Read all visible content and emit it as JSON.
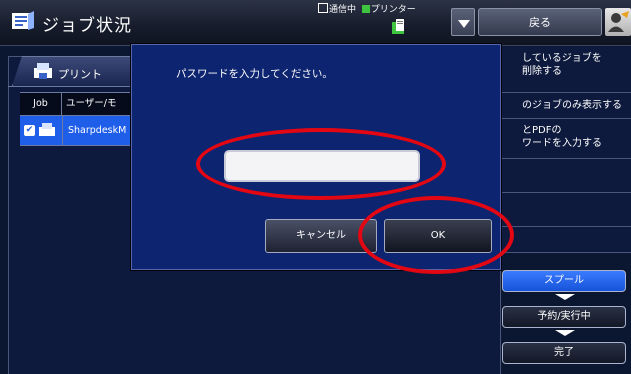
{
  "header": {
    "title": "ジョブ状況",
    "status_comm": "通信中",
    "status_printer": "プリンター",
    "back_label": "戻る",
    "title_icon": "job-status-icon",
    "user_icon": "user-icon",
    "dropdown_icon": "chevron-down-icon"
  },
  "panel": {
    "tab_label": "プリント",
    "tab_icon": "printer-icon",
    "table": {
      "columns": [
        "Job",
        "ユーザー/モ"
      ],
      "rows": [
        {
          "user": "SharpdeskM",
          "selected": true
        }
      ]
    }
  },
  "sidebar": {
    "items": [
      {
        "label": "しているジョブを\n削除する"
      },
      {
        "label": "のジョブのみ表示する"
      },
      {
        "label": "とPDFの\nワードを入力する"
      }
    ],
    "flow": {
      "spool_label": "スプール",
      "queue_label": "予約/実行中",
      "complete_label": "完了"
    }
  },
  "dialog": {
    "message": "パスワードを入力してください。",
    "password_value": "",
    "cancel_label": "キャンセル",
    "ok_label": "OK"
  },
  "colors": {
    "accent": "#1f5ee8",
    "dialog_bg": "#0d2470",
    "annotation": "#e30613",
    "printer_status": "#3ec43e"
  }
}
